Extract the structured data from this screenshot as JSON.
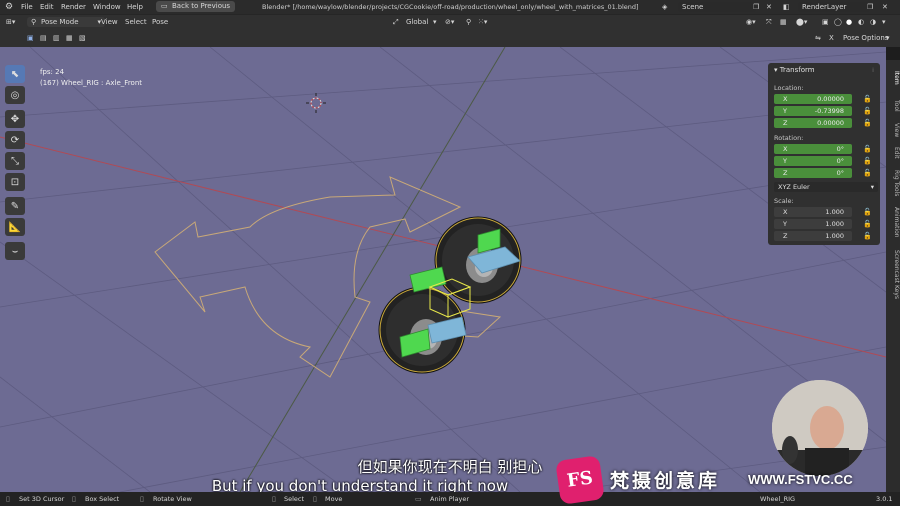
{
  "window": {
    "title": "Blender* [/home/waylow/blender/projects/CGCookie/off-road/production/wheel_only/wheel_with_matrices_01.blend]",
    "menus": [
      "File",
      "Edit",
      "Render",
      "Window",
      "Help"
    ],
    "back_button": "Back to Previous",
    "scene": "Scene",
    "render_layer": "RenderLayer"
  },
  "header": {
    "mode": "Pose Mode",
    "menus": [
      "View",
      "Select",
      "Pose"
    ],
    "orientation": "Global",
    "pose_options": "Pose Options"
  },
  "viewport": {
    "fps": "fps: 24",
    "object_info": "(167) Wheel_RIG : Axle_Front"
  },
  "transform": {
    "title": "Transform",
    "location_label": "Location:",
    "location": [
      {
        "k": "X",
        "v": "0.00000"
      },
      {
        "k": "Y",
        "v": "-0.73998"
      },
      {
        "k": "Z",
        "v": "0.00000"
      }
    ],
    "rotation_label": "Rotation:",
    "rotation": [
      {
        "k": "X",
        "v": "0°"
      },
      {
        "k": "Y",
        "v": "0°"
      },
      {
        "k": "Z",
        "v": "0°"
      }
    ],
    "rotation_mode": "XYZ Euler",
    "scale_label": "Scale:",
    "scale": [
      {
        "k": "X",
        "v": "1.000"
      },
      {
        "k": "Y",
        "v": "1.000"
      },
      {
        "k": "Z",
        "v": "1.000"
      }
    ]
  },
  "side_tabs": [
    "Item",
    "Tool",
    "View",
    "Edit",
    "Rig Tools",
    "Animation",
    "Screencast Keys"
  ],
  "status": {
    "items": [
      "Set 3D Cursor",
      "Box Select",
      "Rotate View",
      "Select",
      "Move",
      "Anim Player"
    ],
    "right": "Wheel_RIG",
    "version": "3.0.1"
  },
  "subtitles": {
    "cn": "但如果你现在不明白 别担心",
    "en": "But if you don't understand it right now"
  },
  "watermark": {
    "brand": "梵摄创意库",
    "url": "WWW.FSTVC.CC",
    "logo": "FS"
  },
  "colors": {
    "viewport_bg": "#6d6b93",
    "accent_green": "#4a8f3b",
    "active_tool": "#5679b5",
    "watermark_pink": "#e0206e"
  }
}
